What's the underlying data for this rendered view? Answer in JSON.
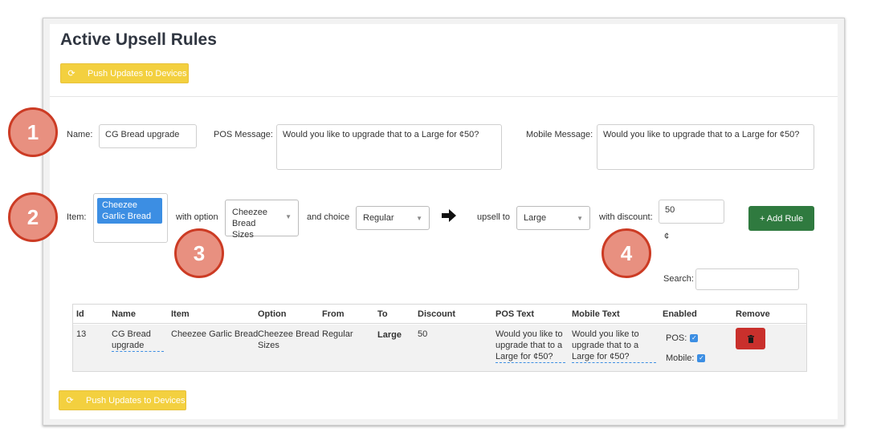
{
  "header": {
    "title": "Active Upsell Rules"
  },
  "push_button": {
    "label": "Push Updates to Devices",
    "icon": "refresh-icon"
  },
  "form": {
    "name_label": "Name:",
    "name_value": "CG Bread upgrade",
    "pos_message_label": "POS Message:",
    "pos_message_value": "Would you like to upgrade that to a Large for ¢50?",
    "mobile_message_label": "Mobile Message:",
    "mobile_message_value": "Would you like to upgrade that to a Large for ¢50?",
    "item_label": "Item:",
    "item_chip_line1": "Cheezee",
    "item_chip_line2": "Garlic Bread",
    "with_option_label": "with option",
    "option_line1": "Cheezee Bread",
    "option_line2": "Sizes",
    "and_choice_label": "and choice",
    "choice_value": "Regular",
    "upsell_to_label": "upsell to",
    "upsell_value": "Large",
    "with_discount_label": "with discount:",
    "discount_value": "50",
    "discount_unit": "¢",
    "add_rule_label": "+ Add Rule",
    "search_label": "Search:",
    "search_value": ""
  },
  "callouts": [
    "1",
    "2",
    "3",
    "4"
  ],
  "table": {
    "columns": [
      "Id",
      "Name",
      "Item",
      "Option",
      "From",
      "To",
      "Discount",
      "POS Text",
      "Mobile Text",
      "Enabled",
      "Remove"
    ],
    "rows": [
      {
        "id": "13",
        "name_line1": "CG Bread",
        "name_line2": "upgrade",
        "item": "Cheezee Garlic Bread",
        "option_line1": "Cheezee Bread",
        "option_line2": "Sizes",
        "from": "Regular",
        "to": "Large",
        "discount": "50",
        "pos_text": [
          "Would you like to",
          "upgrade that to a",
          "Large for ¢50?"
        ],
        "mobile_text": [
          "Would you like to",
          "upgrade that to a",
          "Large for ¢50?"
        ],
        "enabled_pos_label": "POS:",
        "enabled_mobile_label": "Mobile:",
        "enabled_pos": true,
        "enabled_mobile": true,
        "remove_icon": "trash-icon"
      }
    ]
  },
  "colors": {
    "push": "#f3d03f",
    "chip": "#3c8ee3",
    "add": "#2f7a3f",
    "delete": "#c9302c",
    "callout": "#e89080",
    "callout_border": "#cc3b24"
  }
}
